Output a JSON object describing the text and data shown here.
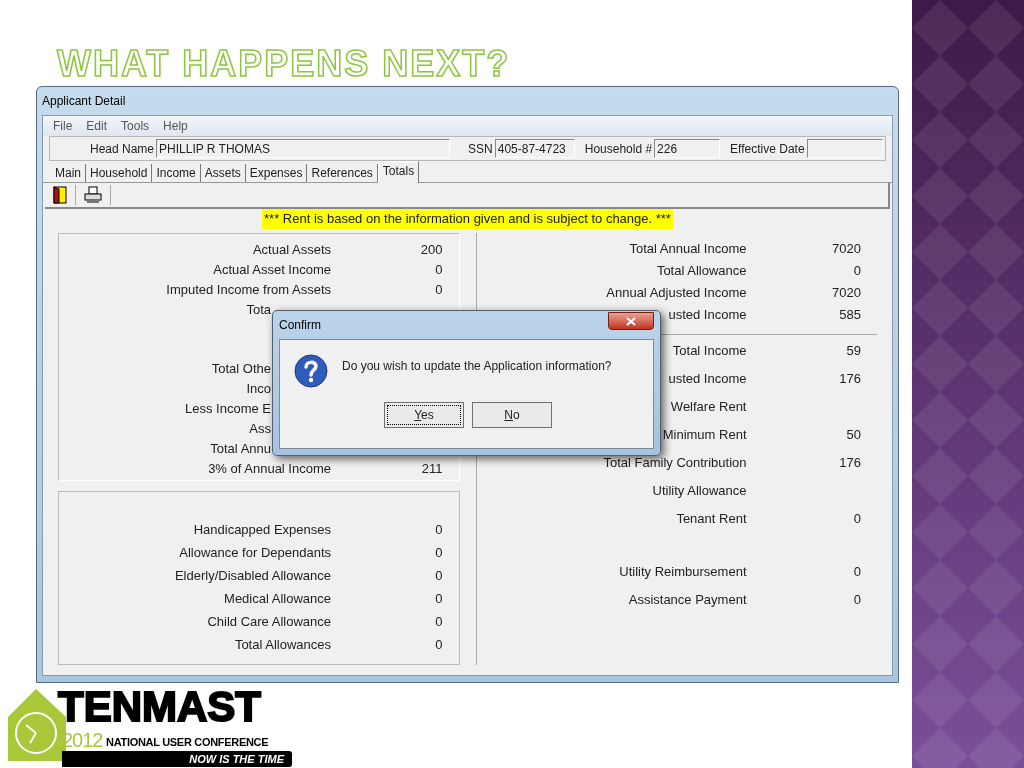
{
  "slide_title": "WHAT HAPPENS NEXT?",
  "window": {
    "title": "Applicant Detail",
    "menu": [
      "File",
      "Edit",
      "Tools",
      "Help"
    ],
    "header_fields": [
      {
        "label": "Head Name",
        "value": "PHILLIP R THOMAS"
      },
      {
        "label": "SSN",
        "value": "405-87-4723"
      },
      {
        "label": "Household #",
        "value": "226"
      },
      {
        "label": "Effective Date"
      }
    ],
    "tabs": [
      {
        "label": "Main",
        "selected": false
      },
      {
        "label": "Household",
        "selected": false
      },
      {
        "label": "Income",
        "selected": false
      },
      {
        "label": "Assets",
        "selected": false
      },
      {
        "label": "Expenses",
        "selected": false
      },
      {
        "label": "References",
        "selected": false
      },
      {
        "label": "Totals",
        "selected": true
      }
    ],
    "notice": "*** Rent is based on the information given and is subject to change. ***",
    "income_panel": [
      {
        "kind": "full",
        "label": "Actual Assets",
        "value": "200"
      },
      {
        "kind": "full",
        "label": "Actual Asset Income",
        "value": "0"
      },
      {
        "kind": "full",
        "label": "Imputed Income from Assets",
        "value": "0"
      },
      {
        "kind": "partial",
        "label": "Tota"
      },
      {
        "kind": "partial",
        "label": "Total Othe"
      },
      {
        "kind": "partial",
        "label": "Inco"
      },
      {
        "kind": "partial",
        "label": "Less Income E"
      },
      {
        "kind": "partial",
        "label": "Ass"
      },
      {
        "kind": "partial",
        "label": "Total Annu"
      },
      {
        "kind": "full",
        "label": "3% of Annual Income",
        "value": "211"
      }
    ],
    "allowance_panel": [
      {
        "label": "Handicapped Expenses",
        "value": "0"
      },
      {
        "label": "Allowance for Dependants",
        "value": "0"
      },
      {
        "label": "Elderly/Disabled Allowance",
        "value": "0"
      },
      {
        "label": "Medical Allowance",
        "value": "0"
      },
      {
        "label": "Child Care Allowance",
        "value": "0"
      },
      {
        "label": "Total Allowances",
        "value": "0"
      }
    ],
    "annual_panel": [
      {
        "label": "Total Annual Income",
        "value": "7020"
      },
      {
        "label": "Total Allowance",
        "value": "0"
      },
      {
        "label": "Annual Adjusted Income",
        "value": "7020"
      },
      {
        "label": "usted Income",
        "value": "585"
      }
    ],
    "rent_panel": [
      {
        "label": "Total Income",
        "value": "59"
      },
      {
        "label": "usted Income",
        "value": "176"
      },
      {
        "label": "Welfare Rent"
      },
      {
        "label": "Minimum Rent",
        "value": "50"
      },
      {
        "label": "Total Family Contribution",
        "value": "176"
      },
      {
        "label": "Utility Allowance"
      },
      {
        "label": "Tenant Rent",
        "value": "0"
      },
      {
        "label": "Utility Reimbursement",
        "value": "0"
      },
      {
        "label": "Assistance Payment",
        "value": "0"
      }
    ]
  },
  "dialog": {
    "title": "Confirm",
    "message": "Do you wish to update the Application information?",
    "buttons": [
      {
        "label": "Yes",
        "focused": true
      },
      {
        "label": "No",
        "focused": false
      }
    ]
  },
  "logo": {
    "name": "TENMAST",
    "year": "2012",
    "subtitle": "NATIONAL USER CONFERENCE",
    "tagline": "NOW IS THE TIME"
  }
}
